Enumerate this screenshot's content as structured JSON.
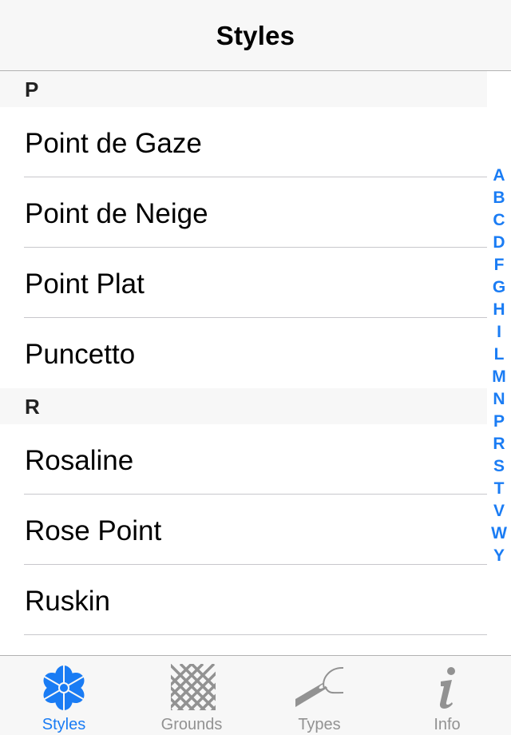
{
  "navbar": {
    "title": "Styles"
  },
  "sections": [
    {
      "header": "P",
      "items": [
        "Point de Gaze",
        "Point de Neige",
        "Point Plat",
        "Puncetto"
      ]
    },
    {
      "header": "R",
      "items": [
        "Rosaline",
        "Rose Point",
        "Ruskin"
      ]
    }
  ],
  "index": [
    "A",
    "B",
    "C",
    "D",
    "F",
    "G",
    "H",
    "I",
    "L",
    "M",
    "N",
    "P",
    "R",
    "S",
    "T",
    "V",
    "W",
    "Y"
  ],
  "tabbar": {
    "tabs": [
      {
        "label": "Styles",
        "icon": "flower-icon",
        "active": true
      },
      {
        "label": "Grounds",
        "icon": "mesh-icon",
        "active": false
      },
      {
        "label": "Types",
        "icon": "needle-thread-icon",
        "active": false
      },
      {
        "label": "Info",
        "icon": "info-icon",
        "active": false
      }
    ]
  },
  "colors": {
    "accent": "#1a7cf4",
    "inactive": "#929292",
    "bar_bg": "#f7f7f7"
  }
}
